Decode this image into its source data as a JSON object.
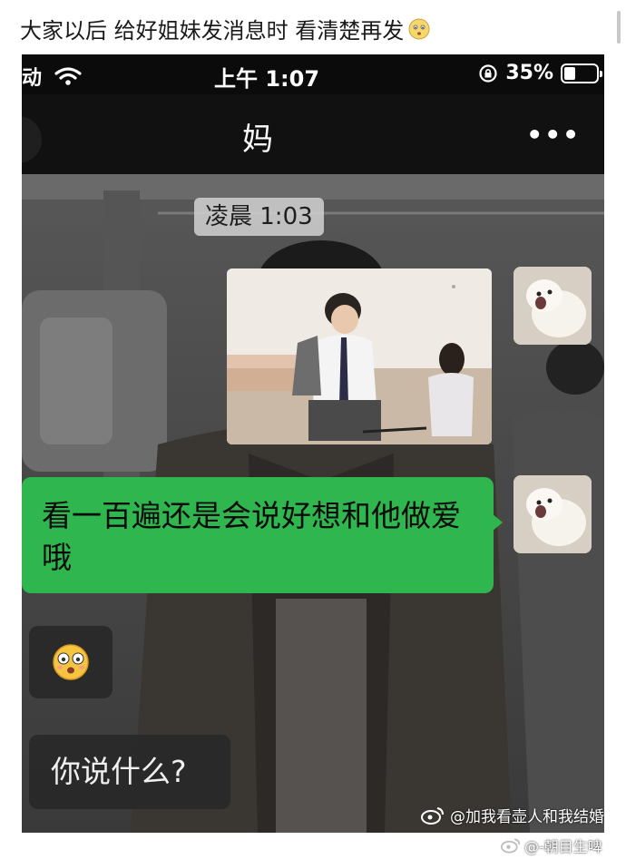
{
  "post": {
    "caption": "大家以后 给好姐妹发消息时 看清楚再发",
    "caption_emoji": "worried-face-emoji"
  },
  "status_bar": {
    "carrier_fragment": "动",
    "wifi_icon": "wifi-icon",
    "time": "上午 1:07",
    "rotation_lock_icon": "rotation-lock-icon",
    "battery_percent": "35%",
    "battery_level": 0.35
  },
  "chat": {
    "title": "妈",
    "more_label": "•••",
    "timestamp": "凌晨 1:03",
    "messages": [
      {
        "type": "image",
        "side": "right",
        "description_icon": "photo-message"
      },
      {
        "type": "text",
        "side": "right",
        "text": "看一百遍还是会说好想和他做爱哦"
      },
      {
        "type": "emoji",
        "side": "left",
        "icon": "dizzy-face-emoji"
      },
      {
        "type": "text",
        "side": "left",
        "text": "你说什么?"
      }
    ]
  },
  "watermarks": {
    "inner": "@加我看壶人和我结婚",
    "outer": "@-朝目生啤"
  },
  "colors": {
    "sent_bubble": "#2fb64e",
    "received_bubble": "#282828",
    "nav_bg": "#111111"
  }
}
